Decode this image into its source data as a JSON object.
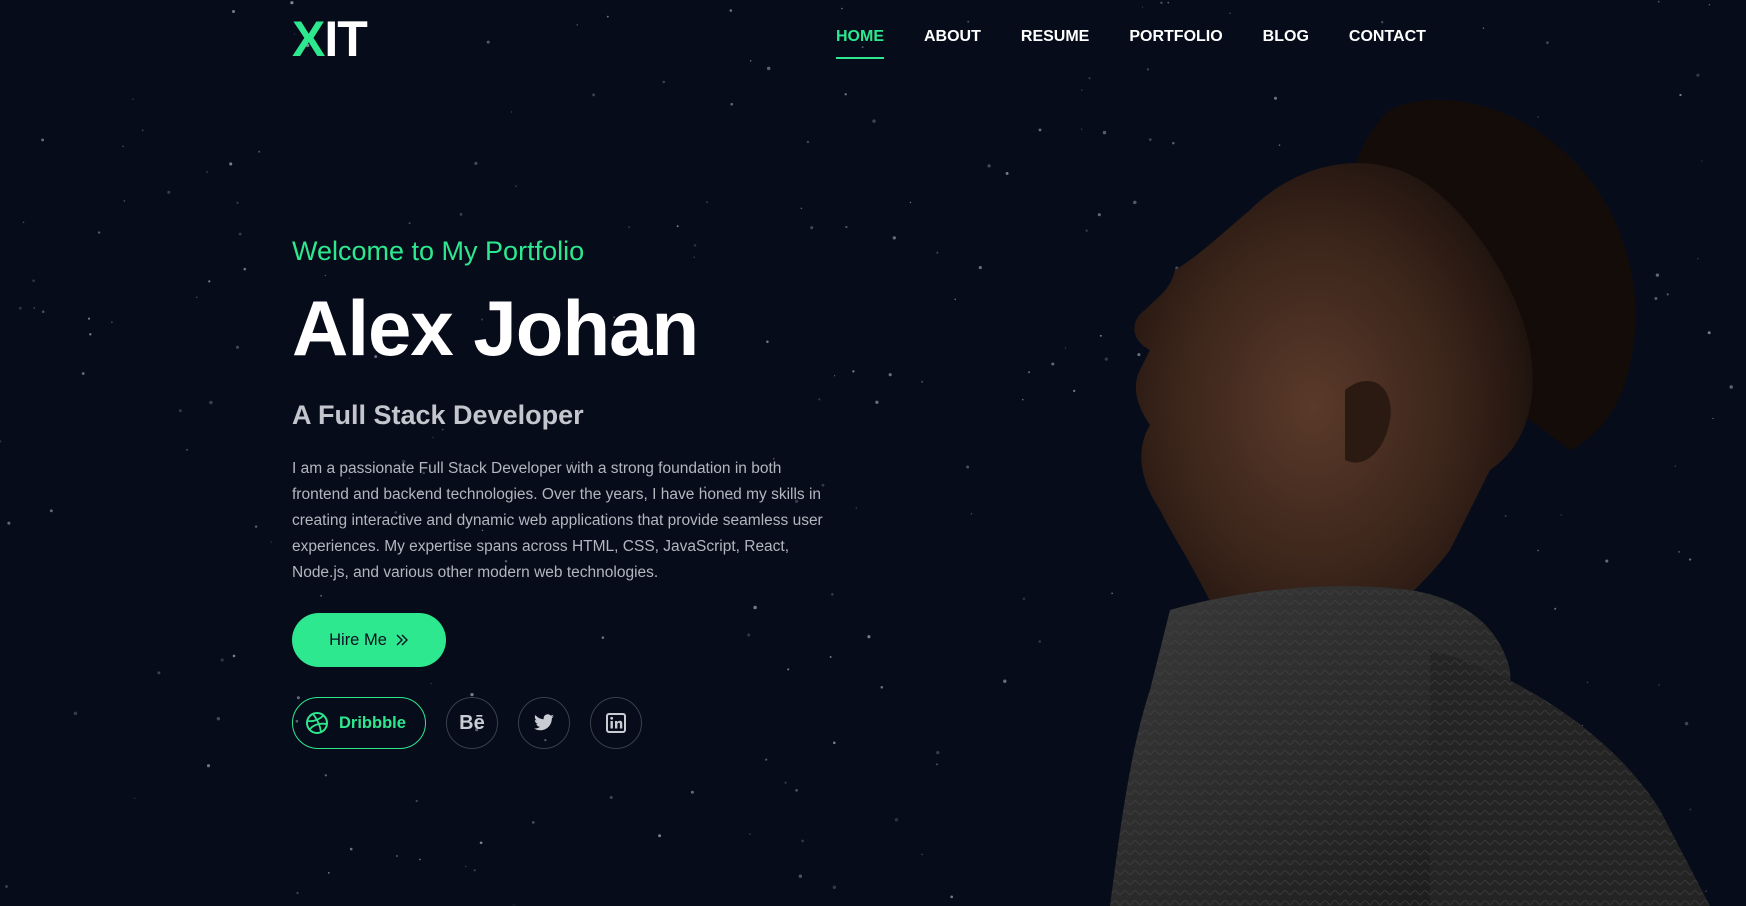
{
  "logo": {
    "mark": "X",
    "rest": "IT"
  },
  "nav": {
    "items": [
      {
        "label": "HOME",
        "active": true
      },
      {
        "label": "ABOUT",
        "active": false
      },
      {
        "label": "RESUME",
        "active": false
      },
      {
        "label": "PORTFOLIO",
        "active": false
      },
      {
        "label": "BLOG",
        "active": false
      },
      {
        "label": "CONTACT",
        "active": false
      }
    ]
  },
  "hero": {
    "welcome": "Welcome to My Portfolio",
    "name": "Alex Johan",
    "role": "A Full Stack Developer",
    "bio": "I am a passionate Full Stack Developer with a strong foundation in both frontend and backend technologies. Over the years, I have honed my skills in creating interactive and dynamic web applications that provide seamless user experiences. My expertise spans across HTML, CSS, JavaScript, React, Node.js, and various other modern web technologies.",
    "hire_label": "Hire Me",
    "hire_icon": "double-chevron-right-icon"
  },
  "socials": {
    "dribbble_label": "Dribbble",
    "behance_text": "Bē",
    "icons": [
      "dribbble-icon",
      "behance-icon",
      "twitter-icon",
      "linkedin-icon"
    ]
  },
  "colors": {
    "background": "#070c1a",
    "accent": "#2ee88f",
    "text": "#ffffff",
    "muted": "#b3b6bf"
  }
}
